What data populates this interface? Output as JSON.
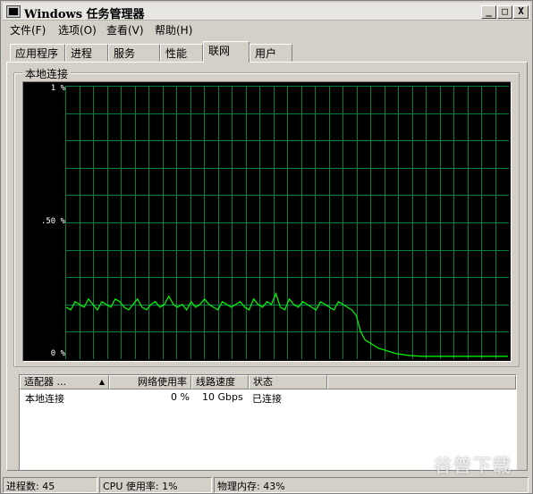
{
  "window": {
    "title": "Windows 任务管理器",
    "minimize": "_",
    "maximize": "□",
    "close": "X"
  },
  "menubar": {
    "items": [
      "文件(F)",
      "选项(O)",
      "查看(V)",
      "帮助(H)"
    ]
  },
  "tabs": [
    "应用程序",
    "进程",
    "服务",
    "性能",
    "联网",
    "用户"
  ],
  "active_tab": "联网",
  "graph": {
    "title": "本地连接",
    "scale_labels": [
      "1 %",
      ".50 %",
      "0 %"
    ],
    "line_color": "#00ff00",
    "grid_color": "#008040"
  },
  "chart_data": {
    "type": "line",
    "ylim": [
      0,
      1
    ],
    "series": [
      {
        "values": [
          0.19,
          0.18,
          0.21,
          0.2,
          0.19,
          0.22,
          0.2,
          0.18,
          0.21,
          0.2,
          0.19,
          0.22,
          0.21,
          0.19,
          0.18,
          0.2,
          0.22,
          0.19,
          0.18,
          0.2,
          0.21,
          0.19,
          0.2,
          0.23,
          0.2,
          0.19,
          0.2,
          0.18,
          0.21,
          0.19,
          0.2,
          0.22,
          0.2,
          0.19,
          0.18,
          0.21,
          0.2,
          0.19,
          0.2,
          0.21,
          0.19,
          0.18,
          0.22,
          0.2,
          0.19,
          0.21,
          0.2,
          0.24,
          0.19,
          0.18,
          0.22,
          0.2,
          0.19,
          0.21,
          0.2,
          0.19,
          0.18,
          0.21,
          0.2,
          0.19,
          0.18,
          0.21,
          0.2,
          0.19,
          0.18,
          0.16,
          0.1,
          0.07,
          0.06,
          0.05,
          0.04,
          0.035,
          0.03,
          0.025,
          0.02,
          0.018,
          0.015,
          0.013,
          0.012,
          0.011,
          0.01,
          0.01,
          0.01,
          0.01,
          0.01,
          0.01,
          0.01,
          0.01,
          0.01,
          0.01,
          0.01,
          0.01,
          0.01,
          0.01,
          0.01,
          0.01,
          0.01,
          0.01,
          0.01,
          0.01
        ]
      }
    ]
  },
  "table": {
    "headers": [
      "适配器 ...",
      "网络使用率",
      "线路速度",
      "状态"
    ],
    "rows": [
      [
        "本地连接",
        "0 %",
        "10 Gbps",
        "已连接"
      ]
    ]
  },
  "status": {
    "processes": "进程数: 45",
    "cpu": "CPU 使用率: 1%",
    "memory": "物理内存: 43%"
  },
  "watermark": "谷普下载"
}
